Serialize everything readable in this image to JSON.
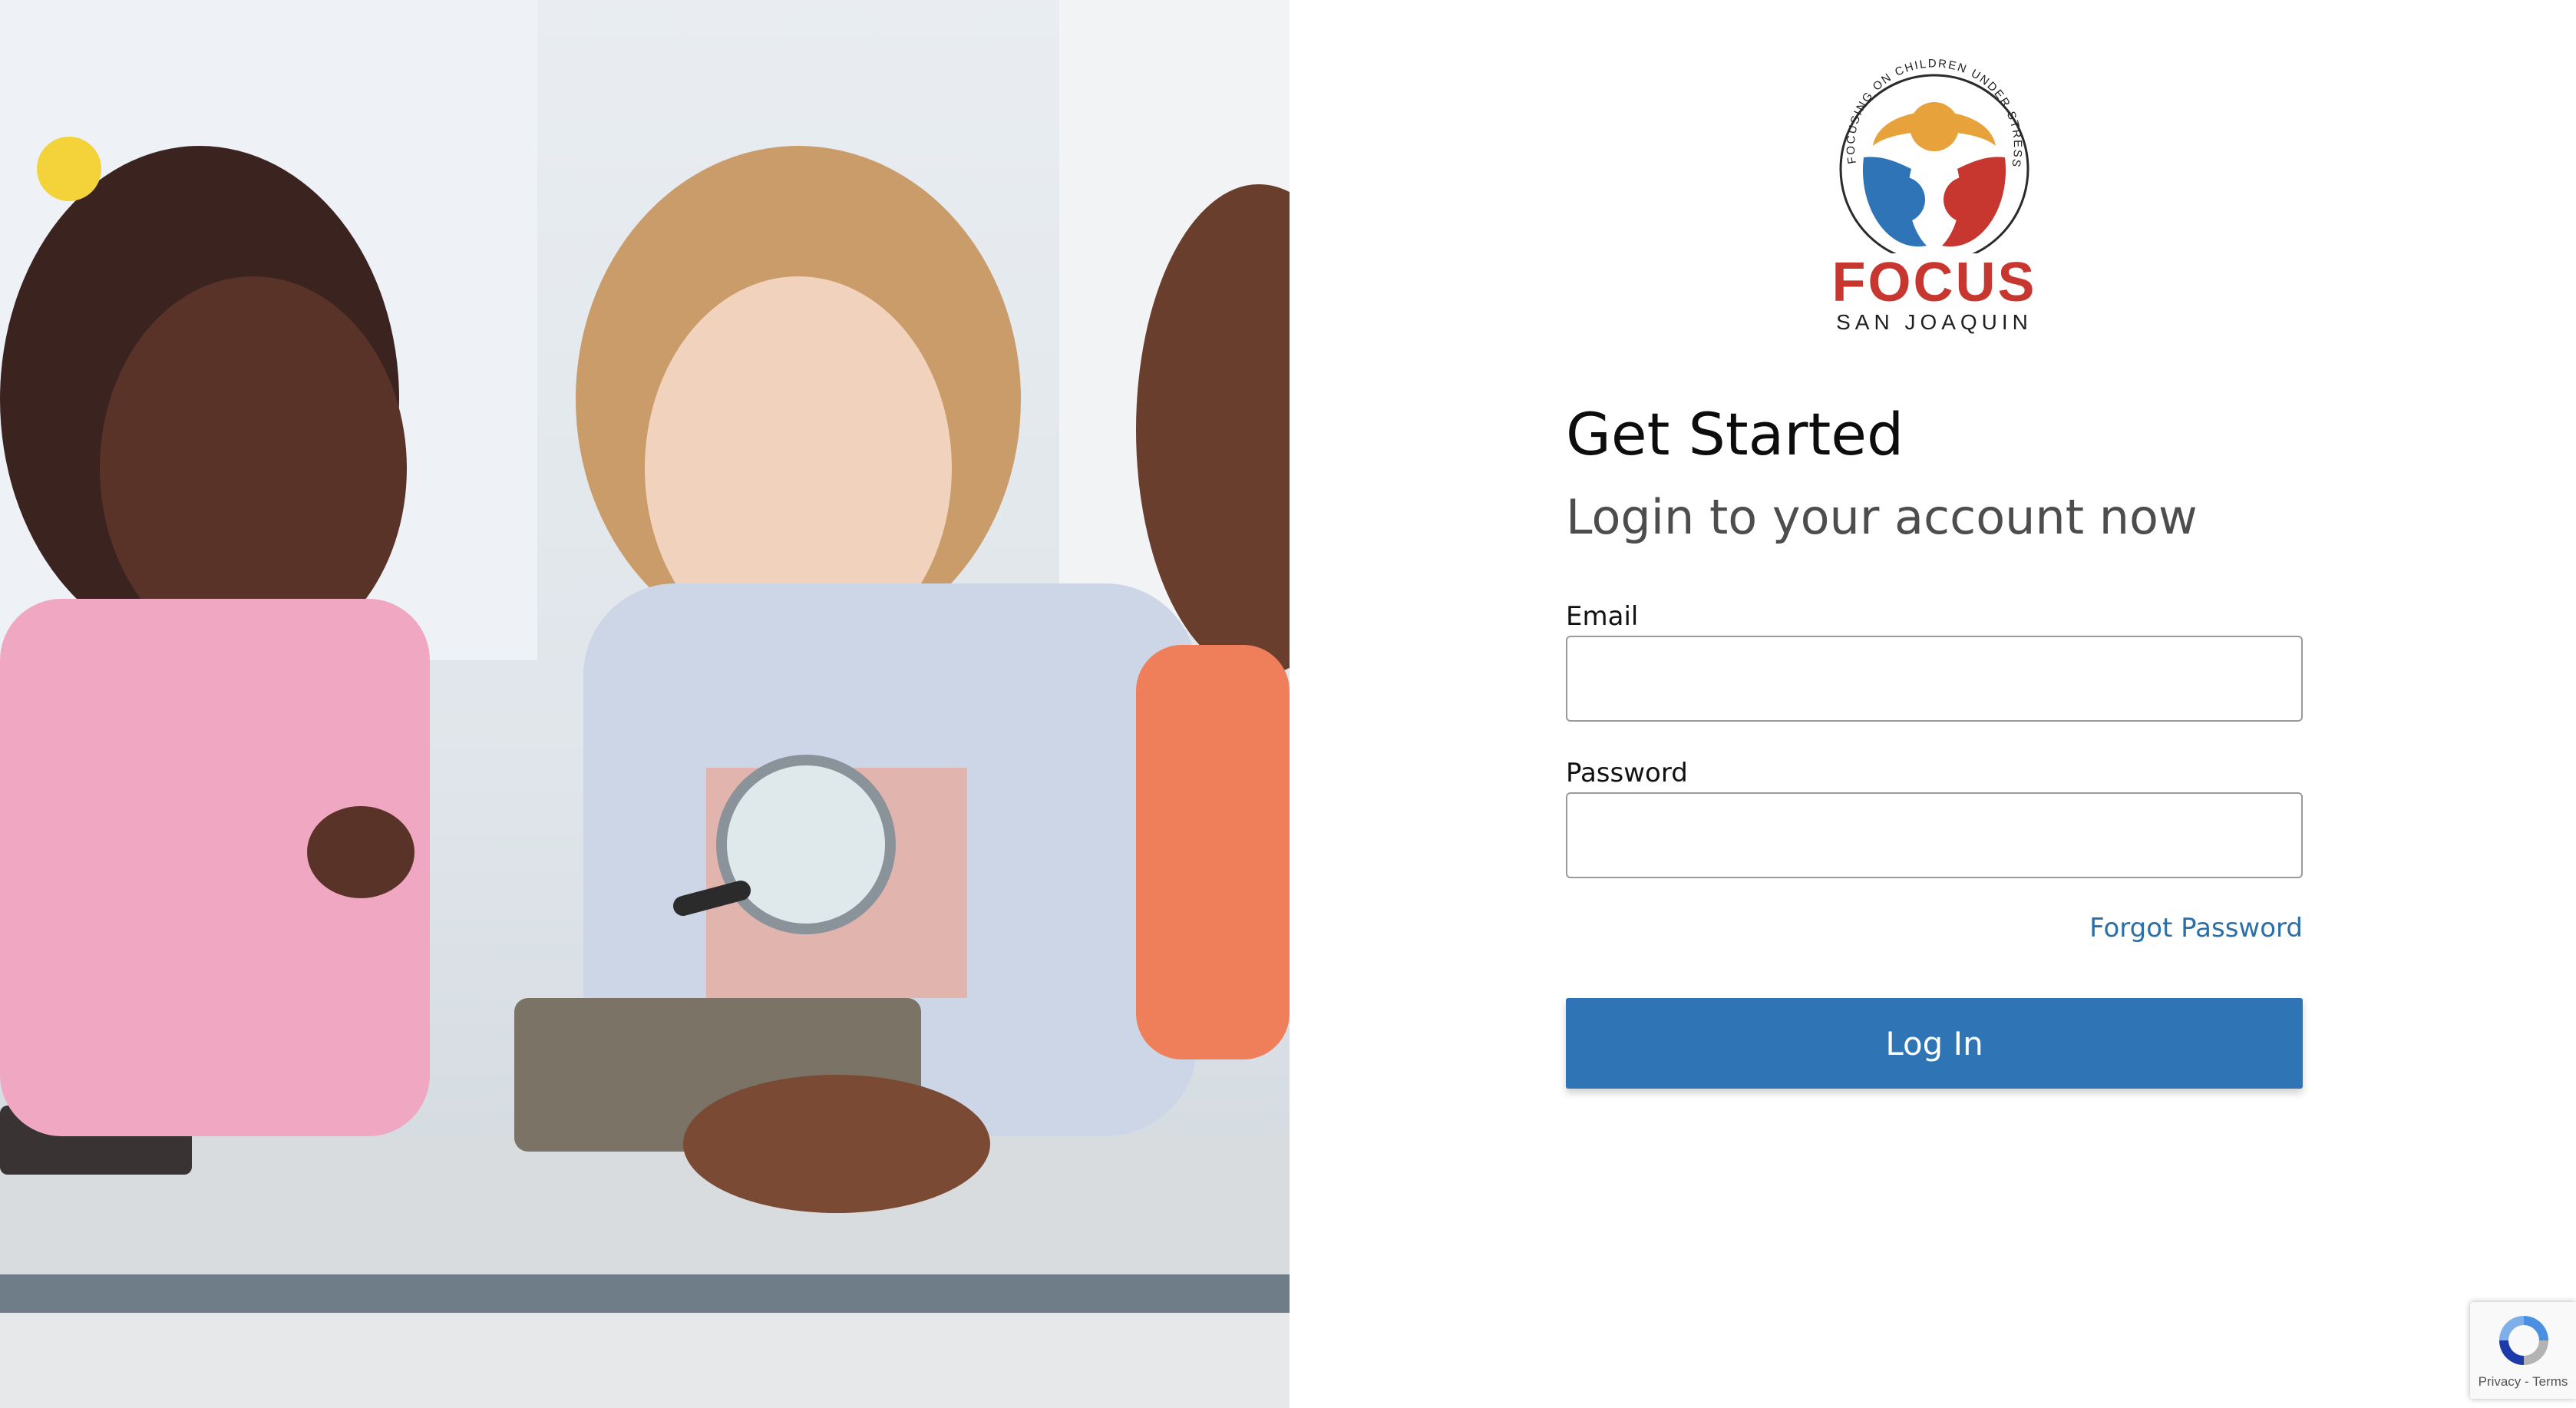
{
  "hero": {
    "alt": "Children examining a rock with a magnifying glass"
  },
  "brand": {
    "ring_text": "FOCUSING ON CHILDREN UNDER STRESS",
    "name": "FOCUS",
    "location": "SAN JOAQUIN",
    "colors": {
      "orange": "#e8a23c",
      "blue": "#2f74b7",
      "red": "#c7362f"
    }
  },
  "login": {
    "heading": "Get Started",
    "subheading": "Login to your account now",
    "email_label": "Email",
    "email_value": "",
    "password_label": "Password",
    "password_value": "",
    "forgot_password": "Forgot Password",
    "submit": "Log In",
    "accent_color": "#2f75b5"
  },
  "recaptcha": {
    "privacy": "Privacy",
    "separator": "-",
    "terms": "Terms"
  }
}
